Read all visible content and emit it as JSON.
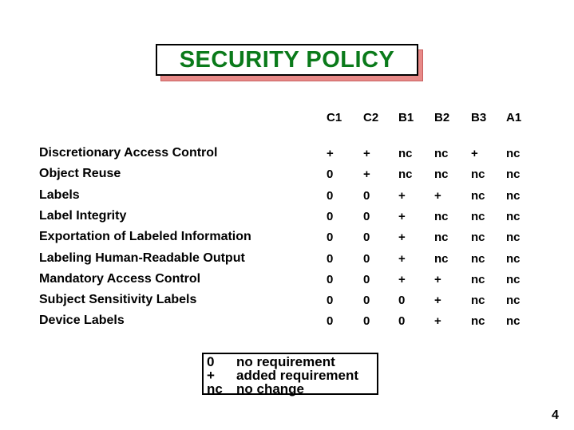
{
  "title": "SECURITY POLICY",
  "colors": {
    "title_text": "#0a7a1a",
    "title_shadow": "#e88a88"
  },
  "columns": [
    "C1",
    "C2",
    "B1",
    "B2",
    "B3",
    "A1"
  ],
  "rows": [
    {
      "label": "Discretionary Access Control",
      "values": [
        "+",
        "+",
        "nc",
        "nc",
        "+",
        "nc"
      ]
    },
    {
      "label": "Object Reuse",
      "values": [
        "0",
        "+",
        "nc",
        "nc",
        "nc",
        "nc"
      ]
    },
    {
      "label": "Labels",
      "values": [
        "0",
        "0",
        "+",
        "+",
        "nc",
        "nc"
      ]
    },
    {
      "label": "Label Integrity",
      "values": [
        "0",
        "0",
        "+",
        "nc",
        "nc",
        "nc"
      ]
    },
    {
      "label": "Exportation of Labeled Information",
      "values": [
        "0",
        "0",
        "+",
        "nc",
        "nc",
        "nc"
      ]
    },
    {
      "label": "Labeling Human-Readable Output",
      "values": [
        "0",
        "0",
        "+",
        "nc",
        "nc",
        "nc"
      ]
    },
    {
      "label": "Mandatory Access Control",
      "values": [
        "0",
        "0",
        "+",
        "+",
        "nc",
        "nc"
      ]
    },
    {
      "label": "Subject Sensitivity Labels",
      "values": [
        "0",
        "0",
        "0",
        "+",
        "nc",
        "nc"
      ]
    },
    {
      "label": "Device Labels",
      "values": [
        "0",
        "0",
        "0",
        "+",
        "nc",
        "nc"
      ]
    }
  ],
  "legend": [
    {
      "symbol": "0",
      "meaning": "no requirement"
    },
    {
      "symbol": "+",
      "meaning": "added requirement"
    },
    {
      "symbol": "nc",
      "meaning": "no change"
    }
  ],
  "page_number": "4"
}
